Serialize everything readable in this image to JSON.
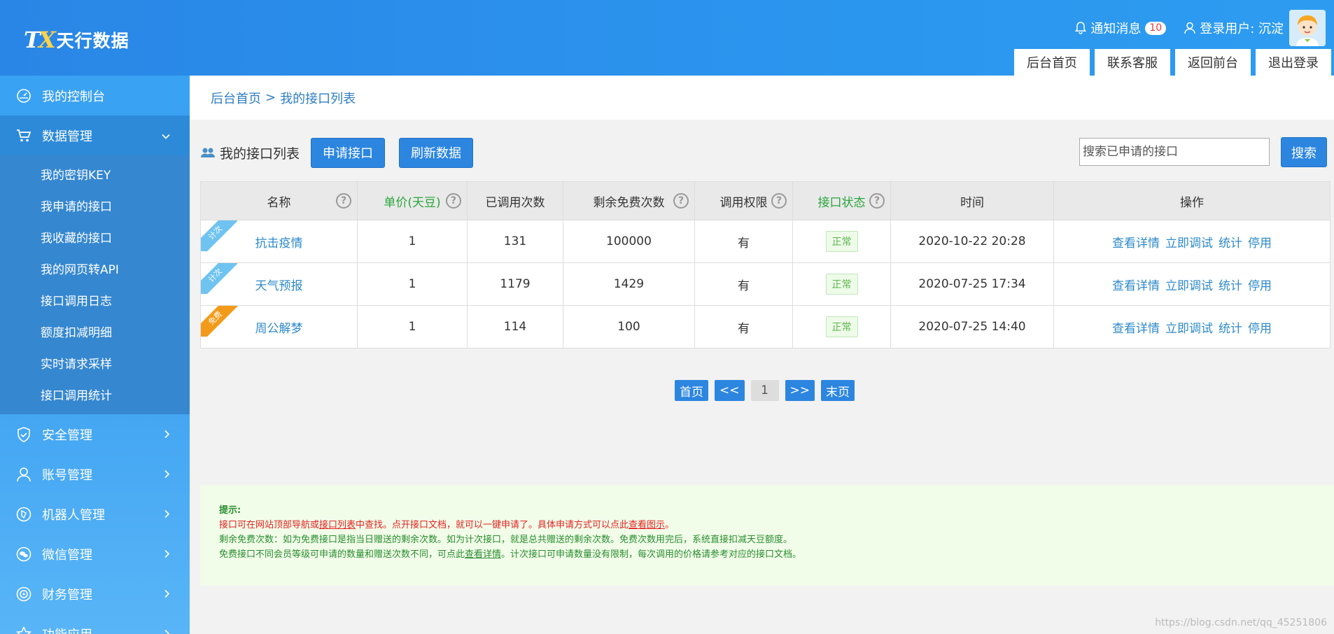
{
  "header": {
    "logo_mark": "TX",
    "logo_text": "天行数据",
    "notice_label": "通知消息",
    "notice_count": "10",
    "user_label": "登录用户: 沉淀",
    "tabs": [
      "后台首页",
      "联系客服",
      "返回前台",
      "退出登录"
    ]
  },
  "sidebar": {
    "items": [
      {
        "label": "我的控制台",
        "icon": "dashboard-icon"
      },
      {
        "label": "数据管理",
        "icon": "cart-icon",
        "open": true,
        "children": [
          "我的密钥KEY",
          "我申请的接口",
          "我收藏的接口",
          "我的网页转API",
          "接口调用日志",
          "额度扣减明细",
          "实时请求采样",
          "接口调用统计"
        ]
      },
      {
        "label": "安全管理",
        "icon": "shield-icon"
      },
      {
        "label": "账号管理",
        "icon": "user-icon"
      },
      {
        "label": "机器人管理",
        "icon": "compass-icon"
      },
      {
        "label": "微信管理",
        "icon": "wechat-icon"
      },
      {
        "label": "财务管理",
        "icon": "finance-icon"
      },
      {
        "label": "功能应用",
        "icon": "star-icon"
      }
    ]
  },
  "breadcrumb": {
    "home": "后台首页",
    "sep": ">",
    "current": "我的接口列表"
  },
  "toolbar": {
    "title": "我的接口列表",
    "apply_label": "申请接口",
    "refresh_label": "刷新数据",
    "search_placeholder": "搜索已申请的接口",
    "search_label": "搜索"
  },
  "table": {
    "columns": [
      "名称",
      "单价(天豆)",
      "已调用次数",
      "剩余免费次数",
      "调用权限",
      "接口状态",
      "时间",
      "操作"
    ],
    "rows": [
      {
        "tag": "计次",
        "tag_color": "#6fc3f0",
        "name": "抗击疫情",
        "price": "1",
        "calls": "131",
        "free": "100000",
        "perm": "有",
        "status": "正常",
        "time": "2020-10-22 20:28"
      },
      {
        "tag": "计次",
        "tag_color": "#6fc3f0",
        "name": "天气预报",
        "price": "1",
        "calls": "1179",
        "free": "1429",
        "perm": "有",
        "status": "正常",
        "time": "2020-07-25 17:34"
      },
      {
        "tag": "免费",
        "tag_color": "#f29b1a",
        "name": "周公解梦",
        "price": "1",
        "calls": "114",
        "free": "100",
        "perm": "有",
        "status": "正常",
        "time": "2020-07-25 14:40"
      }
    ],
    "ops": [
      "查看详情",
      "立即调试",
      "统计",
      "停用"
    ]
  },
  "pager": {
    "first": "首页",
    "prev": "<<",
    "current": "1",
    "next": ">>",
    "last": "末页"
  },
  "tips": {
    "title": "提示:",
    "line1_a": "接口可在网站顶部导航或",
    "line1_link1": "接口列表",
    "line1_b": "中查找。点开接口文档，就可以一键申请了。具体申请方式可以点此",
    "line1_link2": "查看图示",
    "line1_c": "。",
    "line2": "剩余免费次数：如为免费接口是指当日赠送的剩余次数。如为计次接口，就是总共赠送的剩余次数。免费次数用完后，系统直接扣减天豆额度。",
    "line3_a": "免费接口不同会员等级可申请的数量和赠送次数不同，可点此",
    "line3_link": "查看详情",
    "line3_b": "。计次接口可申请数量没有限制，每次调用的价格请参考对应的接口文档。"
  },
  "watermark": "https://blog.csdn.net/qq_45251806",
  "colors": {
    "header": "#2b8fea",
    "sidebar": "#3aa2f2",
    "accent": "#2c86e0",
    "link": "#2e8ac9",
    "status_green": "#5bb54a"
  }
}
